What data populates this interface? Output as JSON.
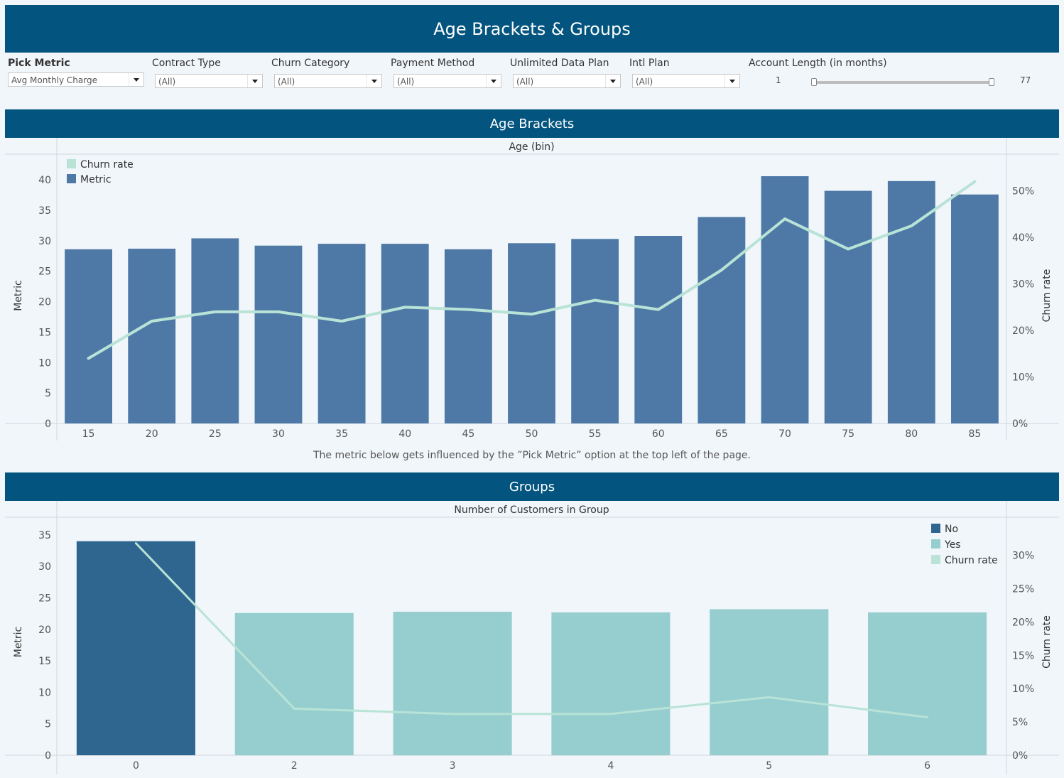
{
  "header": {
    "title": "Age Brackets & Groups"
  },
  "filters": [
    {
      "label": "Pick Metric",
      "value": "Avg Monthly Charge"
    },
    {
      "label": "Contract Type",
      "value": "(All)"
    },
    {
      "label": "Churn Category",
      "value": "(All)"
    },
    {
      "label": "Payment Method",
      "value": "(All)"
    },
    {
      "label": "Unlimited Data Plan",
      "value": "(All)"
    },
    {
      "label": "Intl Plan",
      "value": "(All)"
    }
  ],
  "account_length": {
    "label": "Account Length (in months)",
    "min": "1",
    "max": "77"
  },
  "sections": {
    "age": "Age Brackets",
    "groups": "Groups"
  },
  "caption": "The metric below gets influenced by the ”Pick Metric” option at the top left of the page.",
  "colors": {
    "banner": "#03557f",
    "metric_bar": "#4e79a7",
    "no_bar": "#2f6690",
    "yes_bar": "#96cecf",
    "churn_line": "#b8e3d6"
  },
  "chart_data": [
    {
      "type": "bar",
      "title": "Age (bin)",
      "xlabel": "",
      "ylabel": "Metric",
      "y2label": "Churn rate",
      "categories": [
        "15",
        "20",
        "25",
        "30",
        "35",
        "40",
        "45",
        "50",
        "55",
        "60",
        "65",
        "70",
        "75",
        "80",
        "85"
      ],
      "series": [
        {
          "name": "Metric",
          "type": "bar",
          "axis": "left",
          "values": [
            28.6,
            28.7,
            30.4,
            29.2,
            29.5,
            29.5,
            28.6,
            29.6,
            30.3,
            30.8,
            33.9,
            40.6,
            38.2,
            39.8,
            37.6
          ]
        },
        {
          "name": "Churn rate",
          "type": "line",
          "axis": "right",
          "values": [
            0.14,
            0.22,
            0.24,
            0.24,
            0.22,
            0.25,
            0.245,
            0.235,
            0.265,
            0.245,
            0.33,
            0.44,
            0.375,
            0.425,
            0.52
          ]
        }
      ],
      "ylim": [
        0,
        42
      ],
      "yticks": [
        0,
        5,
        10,
        15,
        20,
        25,
        30,
        35,
        40
      ],
      "y2lim": [
        0,
        0.55
      ],
      "y2ticks": [
        0,
        0.1,
        0.2,
        0.3,
        0.4,
        0.5
      ],
      "y2ticklabels": [
        "0%",
        "10%",
        "20%",
        "30%",
        "40%",
        "50%"
      ],
      "legend": "top-left",
      "legend_items": [
        {
          "name": "Churn rate",
          "color": "#b8e3d6"
        },
        {
          "name": "Metric",
          "color": "#4e79a7"
        }
      ],
      "grid": false
    },
    {
      "type": "bar",
      "title": "Number of Customers in Group",
      "xlabel": "",
      "ylabel": "Metric",
      "y2label": "Churn rate",
      "categories": [
        "0",
        "2",
        "3",
        "4",
        "5",
        "6"
      ],
      "series": [
        {
          "name": "No",
          "type": "bar",
          "axis": "left",
          "values": [
            34.0,
            22.6,
            22.8,
            22.7,
            23.2,
            22.7
          ],
          "colors": [
            "#2f6690",
            "#96cecf",
            "#96cecf",
            "#96cecf",
            "#96cecf",
            "#96cecf"
          ]
        },
        {
          "name": "Churn rate",
          "type": "line",
          "axis": "right",
          "values": [
            0.318,
            0.07,
            0.062,
            0.062,
            0.087,
            0.057
          ]
        }
      ],
      "ylim": [
        0,
        36
      ],
      "yticks": [
        0,
        5,
        10,
        15,
        20,
        25,
        30,
        35
      ],
      "y2lim": [
        0,
        0.34
      ],
      "y2ticks": [
        0,
        0.05,
        0.1,
        0.15,
        0.2,
        0.25,
        0.3
      ],
      "y2ticklabels": [
        "0%",
        "5%",
        "10%",
        "15%",
        "20%",
        "25%",
        "30%"
      ],
      "legend": "top-right",
      "legend_items": [
        {
          "name": "No",
          "color": "#2f6690"
        },
        {
          "name": "Yes",
          "color": "#96cecf"
        },
        {
          "name": "Churn rate",
          "color": "#b8e3d6"
        }
      ],
      "grid": false
    }
  ]
}
